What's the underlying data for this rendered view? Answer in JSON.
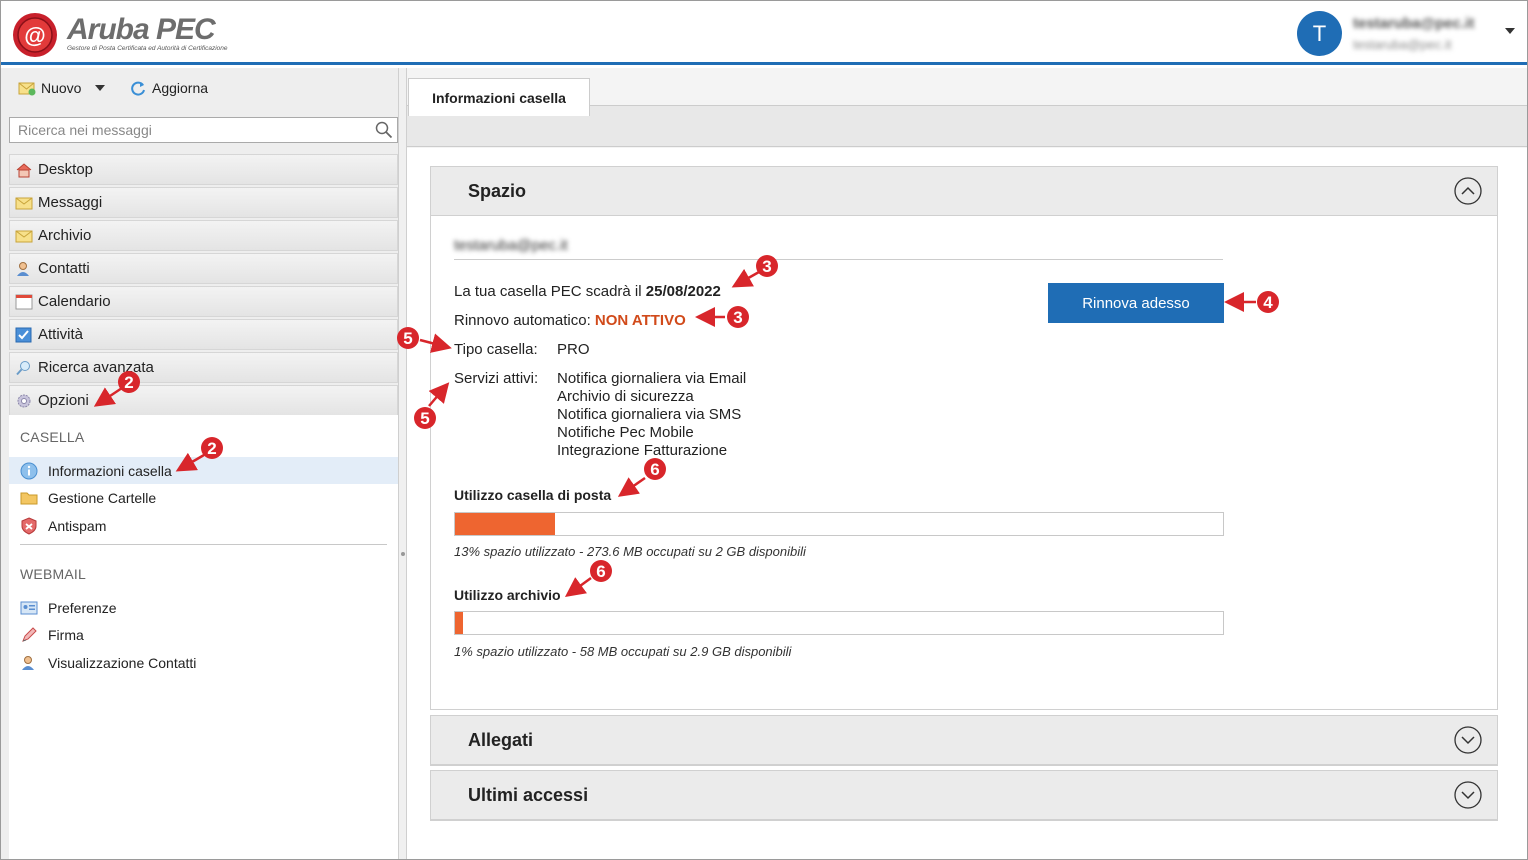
{
  "header": {
    "brand": "Aruba PEC",
    "brand_tagline": "Gestore di Posta Certificata ed Autorità di Certificazione",
    "avatar_letter": "T",
    "user_name": "testaruba@pec.it",
    "user_email": "testaruba@pec.it"
  },
  "toolbar": {
    "new_label": "Nuovo",
    "refresh_label": "Aggiorna"
  },
  "search": {
    "placeholder": "Ricerca nei messaggi"
  },
  "nav": [
    {
      "label": "Desktop",
      "icon": "house-icon"
    },
    {
      "label": "Messaggi",
      "icon": "envelope-icon"
    },
    {
      "label": "Archivio",
      "icon": "archive-envelope-icon"
    },
    {
      "label": "Contatti",
      "icon": "contacts-icon"
    },
    {
      "label": "Calendario",
      "icon": "calendar-icon"
    },
    {
      "label": "Attività",
      "icon": "checkbox-icon"
    },
    {
      "label": "Ricerca avanzata",
      "icon": "magnifier-icon"
    },
    {
      "label": "Opzioni",
      "icon": "gear-icon"
    }
  ],
  "casella": {
    "title": "CASELLA",
    "items": [
      {
        "label": "Informazioni casella",
        "icon": "info-icon"
      },
      {
        "label": "Gestione Cartelle",
        "icon": "folder-icon"
      },
      {
        "label": "Antispam",
        "icon": "shield-icon"
      }
    ]
  },
  "webmail": {
    "title": "WEBMAIL",
    "items": [
      {
        "label": "Preferenze",
        "icon": "id-card-icon"
      },
      {
        "label": "Firma",
        "icon": "pen-icon"
      },
      {
        "label": "Visualizzazione Contatti",
        "icon": "contact-view-icon"
      }
    ]
  },
  "main": {
    "tab_label": "Informazioni casella",
    "spazio": {
      "title": "Spazio",
      "email": "testaruba@pec.it",
      "expiry_prefix": "La tua casella PEC scadrà il",
      "expiry_date": "25/08/2022",
      "auto_renew_label": "Rinnovo automatico:",
      "auto_renew_value": "NON ATTIVO",
      "renew_button": "Rinnova adesso",
      "type_label": "Tipo casella:",
      "type_value": "PRO",
      "services_label": "Servizi attivi:",
      "services": [
        "Notifica giornaliera via Email",
        "Archivio di sicurezza",
        "Notifica giornaliera via SMS",
        "Notifiche Pec Mobile",
        "Integrazione Fatturazione"
      ],
      "mailbox_usage_title": "Utilizzo casella di posta",
      "mailbox_usage_percent": 13,
      "mailbox_usage_note": "13% spazio utilizzato - 273.6 MB occupati su 2 GB disponibili",
      "archive_usage_title": "Utilizzo archivio",
      "archive_usage_percent": 1,
      "archive_usage_note": "1% spazio utilizzato - 58 MB occupati su 2.9 GB disponibili"
    },
    "allegati_title": "Allegati",
    "accessi_title": "Ultimi accessi"
  },
  "annotations": [
    "2",
    "2",
    "3",
    "3",
    "4",
    "5",
    "5",
    "6",
    "6"
  ],
  "colors": {
    "brand_blue": "#1f6db5",
    "accent_orange": "#ee6530",
    "annotation_red": "#d8262b"
  }
}
